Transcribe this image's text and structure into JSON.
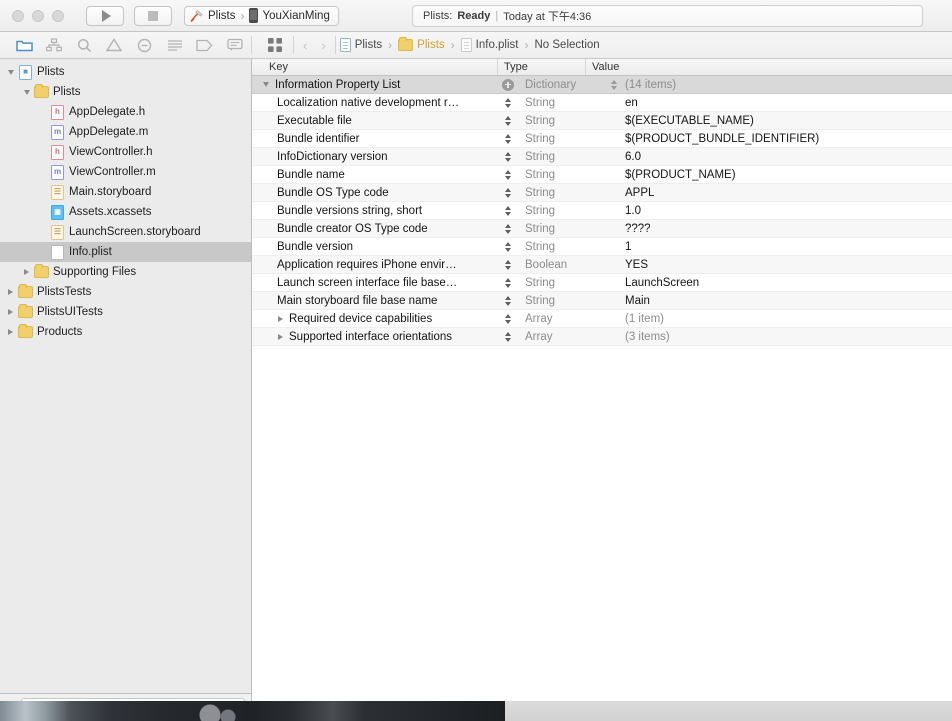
{
  "titlebar": {
    "run_label": "Run",
    "stop_label": "Stop",
    "scheme": {
      "project": "Plists",
      "separator": "›",
      "device": "YouXianMing"
    },
    "status": {
      "prefix": "Plists:",
      "state": "Ready",
      "divider": "|",
      "time": "Today at 下午4:36"
    }
  },
  "navigator_toolbar": {
    "icons": [
      {
        "name": "folder-icon",
        "label": "Project navigator"
      },
      {
        "name": "hierarchy-icon",
        "label": "Source control navigator"
      },
      {
        "name": "search-icon",
        "label": "Find navigator"
      },
      {
        "name": "warning-triangle-icon",
        "label": "Issue navigator"
      },
      {
        "name": "minus-circle-icon",
        "label": "Test navigator"
      },
      {
        "name": "list-icon",
        "label": "Debug navigator"
      },
      {
        "name": "tag-icon",
        "label": "Breakpoint navigator"
      },
      {
        "name": "comment-icon",
        "label": "Report navigator"
      }
    ]
  },
  "breadcrumb": {
    "grid_label": "Editor options",
    "back_label": "‹",
    "forward_label": "›",
    "separator": "›",
    "items": [
      {
        "label": "Plists",
        "icon": "project-icon"
      },
      {
        "label": "Plists",
        "icon": "folder-icon"
      },
      {
        "label": "Info.plist",
        "icon": "plist-icon"
      },
      {
        "label": "No Selection",
        "icon": "none"
      }
    ]
  },
  "navigator": {
    "tree": [
      {
        "label": "Plists",
        "icon": "project-icon",
        "indent": 0,
        "disclosure": "open",
        "selected": false
      },
      {
        "label": "Plists",
        "icon": "folder-icon",
        "indent": 1,
        "disclosure": "open",
        "selected": false
      },
      {
        "label": "AppDelegate.h",
        "icon": "header-file-icon",
        "indent": 2,
        "disclosure": "none",
        "selected": false
      },
      {
        "label": "AppDelegate.m",
        "icon": "implementation-file-icon",
        "indent": 2,
        "disclosure": "none",
        "selected": false
      },
      {
        "label": "ViewController.h",
        "icon": "header-file-icon",
        "indent": 2,
        "disclosure": "none",
        "selected": false
      },
      {
        "label": "ViewController.m",
        "icon": "implementation-file-icon",
        "indent": 2,
        "disclosure": "none",
        "selected": false
      },
      {
        "label": "Main.storyboard",
        "icon": "storyboard-icon",
        "indent": 2,
        "disclosure": "none",
        "selected": false
      },
      {
        "label": "Assets.xcassets",
        "icon": "assets-icon",
        "indent": 2,
        "disclosure": "none",
        "selected": false
      },
      {
        "label": "LaunchScreen.storyboard",
        "icon": "storyboard-icon",
        "indent": 2,
        "disclosure": "none",
        "selected": false
      },
      {
        "label": "Info.plist",
        "icon": "plist-icon",
        "indent": 2,
        "disclosure": "none",
        "selected": true
      },
      {
        "label": "Supporting Files",
        "icon": "folder-icon",
        "indent": 1,
        "disclosure": "closed",
        "selected": false
      },
      {
        "label": "PlistsTests",
        "icon": "folder-icon",
        "indent": 0,
        "disclosure": "closed",
        "selected": false
      },
      {
        "label": "PlistsUITests",
        "icon": "folder-icon",
        "indent": 0,
        "disclosure": "closed",
        "selected": false
      },
      {
        "label": "Products",
        "icon": "folder-icon",
        "indent": 0,
        "disclosure": "closed",
        "selected": false
      }
    ],
    "filter_bar": {
      "add_label": "+",
      "placeholder": "",
      "value": "",
      "recent_icon": "clock-icon",
      "filter_icon": "crossed-box-icon"
    }
  },
  "plist_editor": {
    "columns": {
      "key": "Key",
      "type": "Type",
      "value": "Value"
    },
    "rows": [
      {
        "key": "Information Property List",
        "type": "Dictionary",
        "value": "(14 items)",
        "root": true,
        "disclosure": "open",
        "value_muted": true,
        "control": "add"
      },
      {
        "key": "Localization native development r…",
        "type": "String",
        "value": "en",
        "root": false,
        "disclosure": "none",
        "value_muted": false,
        "control": "stepper"
      },
      {
        "key": "Executable file",
        "type": "String",
        "value": "$(EXECUTABLE_NAME)",
        "root": false,
        "disclosure": "none",
        "value_muted": false,
        "control": "stepper"
      },
      {
        "key": "Bundle identifier",
        "type": "String",
        "value": "$(PRODUCT_BUNDLE_IDENTIFIER)",
        "root": false,
        "disclosure": "none",
        "value_muted": false,
        "control": "stepper"
      },
      {
        "key": "InfoDictionary version",
        "type": "String",
        "value": "6.0",
        "root": false,
        "disclosure": "none",
        "value_muted": false,
        "control": "stepper"
      },
      {
        "key": "Bundle name",
        "type": "String",
        "value": "$(PRODUCT_NAME)",
        "root": false,
        "disclosure": "none",
        "value_muted": false,
        "control": "stepper"
      },
      {
        "key": "Bundle OS Type code",
        "type": "String",
        "value": "APPL",
        "root": false,
        "disclosure": "none",
        "value_muted": false,
        "control": "stepper"
      },
      {
        "key": "Bundle versions string, short",
        "type": "String",
        "value": "1.0",
        "root": false,
        "disclosure": "none",
        "value_muted": false,
        "control": "stepper"
      },
      {
        "key": "Bundle creator OS Type code",
        "type": "String",
        "value": "????",
        "root": false,
        "disclosure": "none",
        "value_muted": false,
        "control": "stepper"
      },
      {
        "key": "Bundle version",
        "type": "String",
        "value": "1",
        "root": false,
        "disclosure": "none",
        "value_muted": false,
        "control": "stepper"
      },
      {
        "key": "Application requires iPhone envir…",
        "type": "Boolean",
        "value": "YES",
        "root": false,
        "disclosure": "none",
        "value_muted": false,
        "control": "stepper"
      },
      {
        "key": "Launch screen interface file base…",
        "type": "String",
        "value": "LaunchScreen",
        "root": false,
        "disclosure": "none",
        "value_muted": false,
        "control": "stepper"
      },
      {
        "key": "Main storyboard file base name",
        "type": "String",
        "value": "Main",
        "root": false,
        "disclosure": "none",
        "value_muted": false,
        "control": "stepper"
      },
      {
        "key": "Required device capabilities",
        "type": "Array",
        "value": "(1 item)",
        "root": false,
        "disclosure": "closed",
        "value_muted": true,
        "control": "stepper"
      },
      {
        "key": "Supported interface orientations",
        "type": "Array",
        "value": "(3 items)",
        "root": false,
        "disclosure": "closed",
        "value_muted": true,
        "control": "stepper"
      }
    ]
  },
  "colors": {
    "selection_gray": "#c8c8c8",
    "root_row_gray": "#d9d9d9",
    "folder_yellow": "#f0cf6c",
    "assets_blue": "#5ec0ef"
  }
}
